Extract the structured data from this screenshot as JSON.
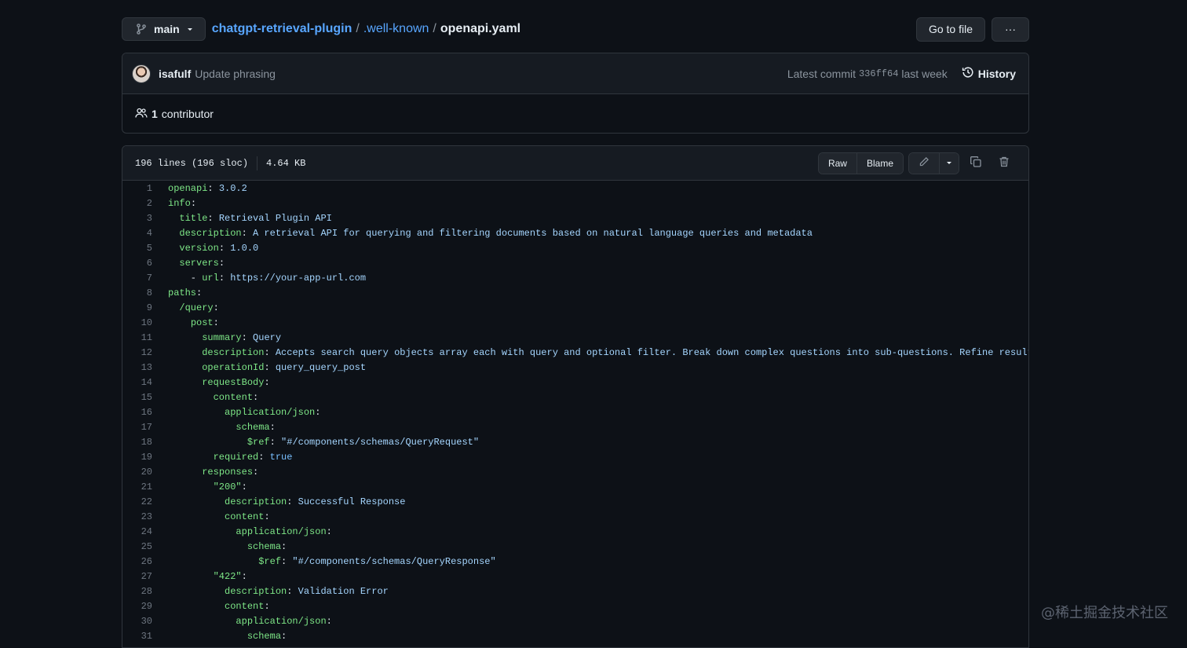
{
  "top_bar": {
    "branch": "main",
    "breadcrumb": {
      "repo": "chatgpt-retrieval-plugin",
      "sep": "/",
      "folder": ".well-known",
      "file": "openapi.yaml"
    },
    "go_to_file": "Go to file",
    "more": "···"
  },
  "commit": {
    "author": "isafulf",
    "message": "Update phrasing",
    "latest_label": "Latest commit",
    "sha": "336ff64",
    "time": "last week",
    "history_label": "History"
  },
  "contributors": {
    "count": "1",
    "label": "contributor"
  },
  "file": {
    "lines_info": "196 lines (196 sloc)",
    "size": "4.64 KB",
    "raw_label": "Raw",
    "blame_label": "Blame"
  },
  "code_lines": [
    {
      "n": "1",
      "indent": "",
      "key": "openapi",
      "colon": ":",
      "value": " 3.0.2",
      "vclass": "v"
    },
    {
      "n": "2",
      "indent": "",
      "key": "info",
      "colon": ":",
      "value": "",
      "vclass": "v"
    },
    {
      "n": "3",
      "indent": "  ",
      "key": "title",
      "colon": ":",
      "value": " Retrieval Plugin API",
      "vclass": "v"
    },
    {
      "n": "4",
      "indent": "  ",
      "key": "description",
      "colon": ":",
      "value": " A retrieval API for querying and filtering documents based on natural language queries and metadata",
      "vclass": "v"
    },
    {
      "n": "5",
      "indent": "  ",
      "key": "version",
      "colon": ":",
      "value": " 1.0.0",
      "vclass": "v"
    },
    {
      "n": "6",
      "indent": "  ",
      "key": "servers",
      "colon": ":",
      "value": "",
      "vclass": "v"
    },
    {
      "n": "7",
      "indent": "    - ",
      "key": "url",
      "colon": ":",
      "value": " https://your-app-url.com",
      "vclass": "v"
    },
    {
      "n": "8",
      "indent": "",
      "key": "paths",
      "colon": ":",
      "value": "",
      "vclass": "v"
    },
    {
      "n": "9",
      "indent": "  ",
      "key": "/query",
      "colon": ":",
      "value": "",
      "vclass": "v"
    },
    {
      "n": "10",
      "indent": "    ",
      "key": "post",
      "colon": ":",
      "value": "",
      "vclass": "v"
    },
    {
      "n": "11",
      "indent": "      ",
      "key": "summary",
      "colon": ":",
      "value": " Query",
      "vclass": "v"
    },
    {
      "n": "12",
      "indent": "      ",
      "key": "description",
      "colon": ":",
      "value": " Accepts search query objects array each with query and optional filter. Break down complex questions into sub-questions. Refine results by cr",
      "vclass": "v"
    },
    {
      "n": "13",
      "indent": "      ",
      "key": "operationId",
      "colon": ":",
      "value": " query_query_post",
      "vclass": "v"
    },
    {
      "n": "14",
      "indent": "      ",
      "key": "requestBody",
      "colon": ":",
      "value": "",
      "vclass": "v"
    },
    {
      "n": "15",
      "indent": "        ",
      "key": "content",
      "colon": ":",
      "value": "",
      "vclass": "v"
    },
    {
      "n": "16",
      "indent": "          ",
      "key": "application/json",
      "colon": ":",
      "value": "",
      "vclass": "v"
    },
    {
      "n": "17",
      "indent": "            ",
      "key": "schema",
      "colon": ":",
      "value": "",
      "vclass": "v"
    },
    {
      "n": "18",
      "indent": "              ",
      "key": "$ref",
      "colon": ":",
      "value": " \"#/components/schemas/QueryRequest\"",
      "vclass": "v"
    },
    {
      "n": "19",
      "indent": "        ",
      "key": "required",
      "colon": ":",
      "value": " true",
      "vclass": "b"
    },
    {
      "n": "20",
      "indent": "      ",
      "key": "responses",
      "colon": ":",
      "value": "",
      "vclass": "v"
    },
    {
      "n": "21",
      "indent": "        ",
      "key": "\"200\"",
      "colon": ":",
      "value": "",
      "vclass": "v"
    },
    {
      "n": "22",
      "indent": "          ",
      "key": "description",
      "colon": ":",
      "value": " Successful Response",
      "vclass": "v"
    },
    {
      "n": "23",
      "indent": "          ",
      "key": "content",
      "colon": ":",
      "value": "",
      "vclass": "v"
    },
    {
      "n": "24",
      "indent": "            ",
      "key": "application/json",
      "colon": ":",
      "value": "",
      "vclass": "v"
    },
    {
      "n": "25",
      "indent": "              ",
      "key": "schema",
      "colon": ":",
      "value": "",
      "vclass": "v"
    },
    {
      "n": "26",
      "indent": "                ",
      "key": "$ref",
      "colon": ":",
      "value": " \"#/components/schemas/QueryResponse\"",
      "vclass": "v"
    },
    {
      "n": "27",
      "indent": "        ",
      "key": "\"422\"",
      "colon": ":",
      "value": "",
      "vclass": "v"
    },
    {
      "n": "28",
      "indent": "          ",
      "key": "description",
      "colon": ":",
      "value": " Validation Error",
      "vclass": "v"
    },
    {
      "n": "29",
      "indent": "          ",
      "key": "content",
      "colon": ":",
      "value": "",
      "vclass": "v"
    },
    {
      "n": "30",
      "indent": "            ",
      "key": "application/json",
      "colon": ":",
      "value": "",
      "vclass": "v"
    },
    {
      "n": "31",
      "indent": "              ",
      "key": "schema",
      "colon": ":",
      "value": "",
      "vclass": "v"
    }
  ],
  "watermark": "@稀土掘金技术社区"
}
